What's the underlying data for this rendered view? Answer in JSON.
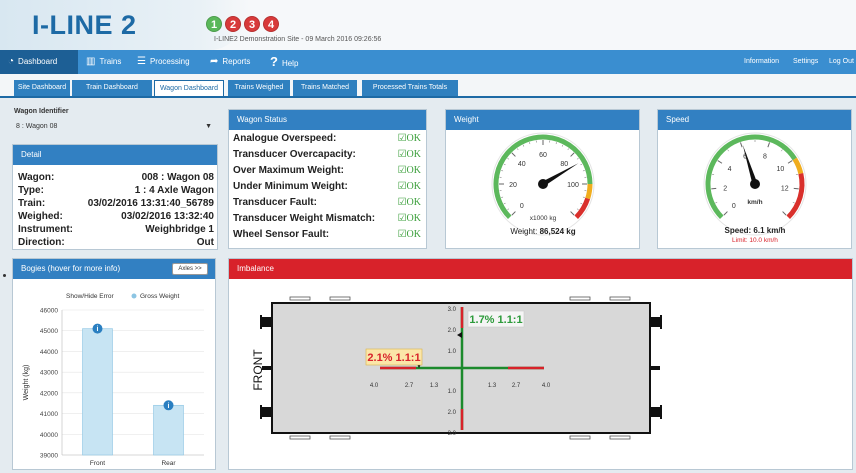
{
  "header": {
    "logo": "I-LINE 2",
    "steps": [
      "1",
      "2",
      "3",
      "4"
    ],
    "site_title": "I-LINE2 Demonstration Site - 09 March 2016 09:26:56"
  },
  "main_nav": {
    "items": [
      {
        "label": "Dashboard",
        "icon": "dashboard-icon"
      },
      {
        "label": "Trains",
        "icon": "train-icon"
      },
      {
        "label": "Processing",
        "icon": "list-icon"
      },
      {
        "label": "Reports",
        "icon": "export-icon"
      },
      {
        "label": "Help",
        "icon": "question-icon"
      }
    ],
    "right": [
      "Information",
      "Settings",
      "Log Out"
    ]
  },
  "sub_nav": {
    "tabs": [
      "Site Dashboard",
      "Train Dashboard",
      "Wagon Dashboard",
      "Trains Weighed",
      "Trains Matched",
      "Processed Trains Totals"
    ],
    "active": "Wagon Dashboard"
  },
  "wagon_identifier": {
    "label": "Wagon Identifier",
    "value": "8 : Wagon 08"
  },
  "detail": {
    "title": "Detail",
    "rows": [
      {
        "k": "Wagon:",
        "v": "008 : Wagon 08"
      },
      {
        "k": "Type:",
        "v": "1 : 4 Axle Wagon"
      },
      {
        "k": "Train:",
        "v": "03/02/2016 13:31:40_56789"
      },
      {
        "k": "Weighed:",
        "v": "03/02/2016 13:32:40"
      },
      {
        "k": "Instrument:",
        "v": "Weighbridge 1"
      },
      {
        "k": "Direction:",
        "v": "Out"
      }
    ]
  },
  "wagon_status": {
    "title": "Wagon Status",
    "rows": [
      {
        "k": "Analogue Overspeed:",
        "v": "OK"
      },
      {
        "k": "Transducer Overcapacity:",
        "v": "OK"
      },
      {
        "k": "Over Maximum Weight:",
        "v": "OK"
      },
      {
        "k": "Under Minimum Weight:",
        "v": "OK"
      },
      {
        "k": "Transducer Fault:",
        "v": "OK"
      },
      {
        "k": "Transducer Weight Mismatch:",
        "v": "OK"
      },
      {
        "k": "Wheel Sensor Fault:",
        "v": "OK"
      }
    ]
  },
  "weight_gauge": {
    "title": "Weight",
    "ticks": [
      "0",
      "20",
      "40",
      "60",
      "80",
      "100"
    ],
    "unit": "x1000 kg",
    "reading_label": "Weight:",
    "reading_value": "86,524 kg",
    "max": 120,
    "value": 86.5
  },
  "speed_gauge": {
    "title": "Speed",
    "ticks": [
      "0",
      "2",
      "4",
      "6",
      "8",
      "10",
      "12"
    ],
    "unit": "km/h",
    "reading": "Speed: 6.1 km/h",
    "limit": "Limit: 10.0 km/h",
    "max": 14,
    "value": 6.1
  },
  "bogies": {
    "title": "Bogies (hover for more info)",
    "axles_button": "Axles >>",
    "legend": "Show/Hide Error",
    "series_label": "Gross Weight"
  },
  "chart_data": {
    "type": "bar",
    "categories": [
      "Front",
      "Rear"
    ],
    "values": [
      45100,
      41400
    ],
    "xlabel": "",
    "ylabel": "Weight (kg)",
    "ylim": [
      39000,
      46000
    ],
    "yticks": [
      "39000",
      "40000",
      "41000",
      "42000",
      "43000",
      "44000",
      "45000",
      "46000"
    ],
    "legend": [
      "Show/Hide Error",
      "Gross Weight"
    ],
    "colors": {
      "bar": "#c7e4f3",
      "bar_stroke": "#8cc5e3",
      "info": "#2a7fc1"
    }
  },
  "imbalance": {
    "title": "Imbalance",
    "front_label": "FRONT",
    "longitudinal": "1.7% 1.1:1",
    "transverse": "2.1% 1.1:1",
    "x_ticks": [
      "4.0",
      "2.7",
      "1.3",
      "1.3",
      "2.7",
      "4.0"
    ],
    "y_ticks": [
      "3.0",
      "2.0",
      "1.0",
      "1.0",
      "2.0",
      "3.0"
    ]
  },
  "colors": {
    "brand": "#1d6aa5",
    "nav": "#3a8ed0",
    "panel_header": "#3280c2",
    "alert": "#d8222a",
    "ok": "#3da03d"
  }
}
